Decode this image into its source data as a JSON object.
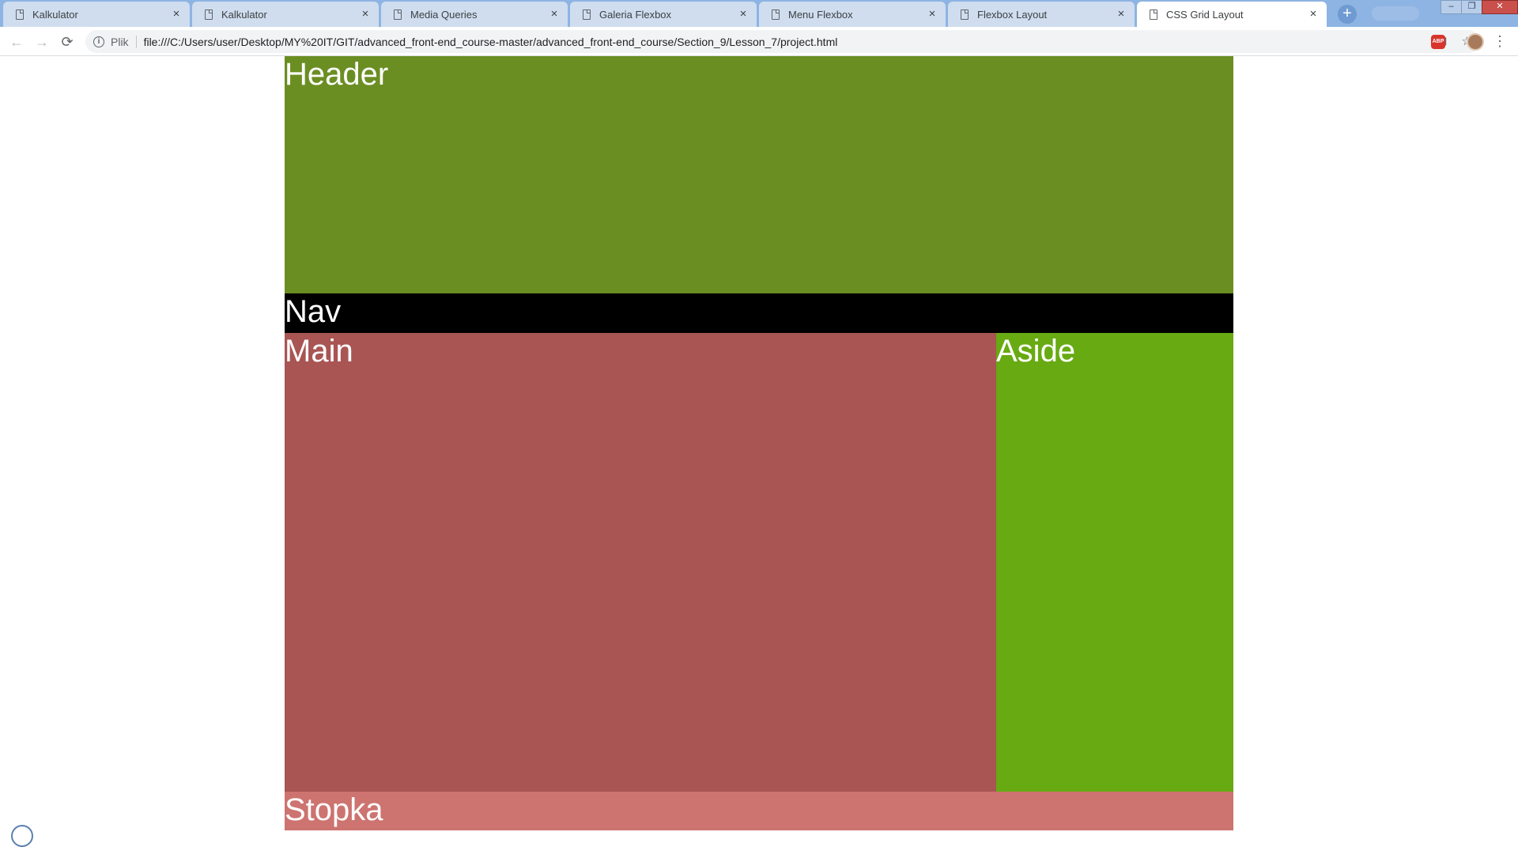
{
  "browser": {
    "tabs": [
      {
        "title": "Kalkulator",
        "active": false
      },
      {
        "title": "Kalkulator",
        "active": false
      },
      {
        "title": "Media Queries",
        "active": false
      },
      {
        "title": "Galeria Flexbox",
        "active": false
      },
      {
        "title": "Menu Flexbox",
        "active": false
      },
      {
        "title": "Flexbox Layout",
        "active": false
      },
      {
        "title": "CSS Grid Layout",
        "active": true
      }
    ],
    "new_tab_label": "+",
    "close_glyph": "×",
    "window_controls": {
      "minimize": "–",
      "maximize": "❐",
      "close": "✕"
    },
    "toolbar": {
      "back_glyph": "←",
      "forward_glyph": "→",
      "reload_glyph": "⟳",
      "scheme_label": "Plik",
      "url": "file:///C:/Users/user/Desktop/MY%20IT/GIT/advanced_front-end_course-master/advanced_front-end_course/Section_9/Lesson_7/project.html",
      "translate_glyph": "⊡",
      "star_glyph": "☆",
      "adblock_label": "ABP",
      "menu_glyph": "⋮"
    },
    "theme_color": "#8db4e3"
  },
  "page": {
    "header": {
      "label": "Header",
      "color": "#6b8e23"
    },
    "nav": {
      "label": "Nav",
      "color": "#000000"
    },
    "main": {
      "label": "Main",
      "color": "#a85553"
    },
    "aside": {
      "label": "Aside",
      "color": "#67aa12"
    },
    "footer": {
      "label": "Stopka",
      "color": "#cd7370"
    }
  }
}
